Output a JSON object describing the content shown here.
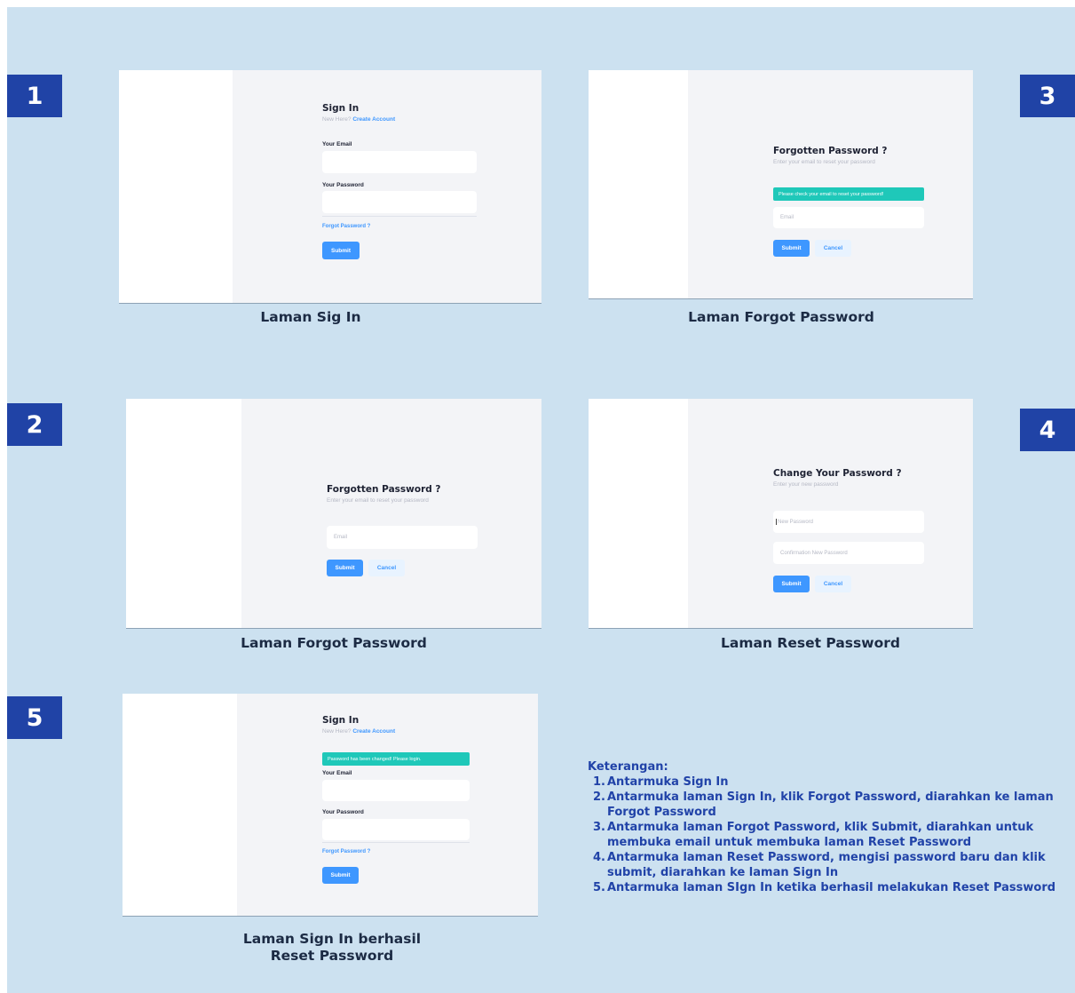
{
  "panels": {
    "p1": {
      "badge": "1",
      "caption": "Laman Sig In"
    },
    "p2": {
      "badge": "2",
      "caption": "Laman Forgot Password"
    },
    "p3": {
      "badge": "3",
      "caption": "Laman Forgot Password"
    },
    "p4": {
      "badge": "4",
      "caption": "Laman Reset Password"
    },
    "p5": {
      "badge": "5",
      "caption_line1": "Laman Sign In berhasil",
      "caption_line2": "Reset Password"
    }
  },
  "signin": {
    "title": "Sign In",
    "new_here": "New Here?",
    "create_account": "Create Account",
    "email_label": "Your Email",
    "password_label": "Your Password",
    "forgot_link": "Forgot Password ?",
    "submit": "Submit",
    "success_alert": "Password has been changed! Please login."
  },
  "forgot": {
    "title": "Forgotten Password ?",
    "subtitle": "Enter your email to reset your password",
    "alert": "Please check your email to reset your password!",
    "email_placeholder": "Email",
    "submit": "Submit",
    "cancel": "Cancel"
  },
  "reset": {
    "title": "Change Your Password ?",
    "subtitle": "Enter your new password",
    "new_password_placeholder": "New Password",
    "confirm_placeholder": "Confirmation New Password",
    "submit": "Submit",
    "cancel": "Cancel"
  },
  "notes": {
    "heading": "Keterangan:",
    "items": [
      "Antarmuka Sign In",
      "Antarmuka laman Sign In, klik Forgot Password, diarahkan ke laman Forgot Password",
      "Antarmuka laman Forgot Password, klik Submit, diarahkan untuk membuka email untuk membuka laman Reset Password",
      "Antarmuka laman Reset Password, mengisi password baru dan klik submit, diarahkan ke laman Sign In",
      "Antarmuka laman SIgn In ketika berhasil melakukan Reset Password"
    ]
  },
  "colors": {
    "background": "#cce1f0",
    "badge": "#2043a6",
    "primary": "#3e97ff",
    "alert": "#1fc8b9",
    "notes_text": "#2143a8"
  }
}
